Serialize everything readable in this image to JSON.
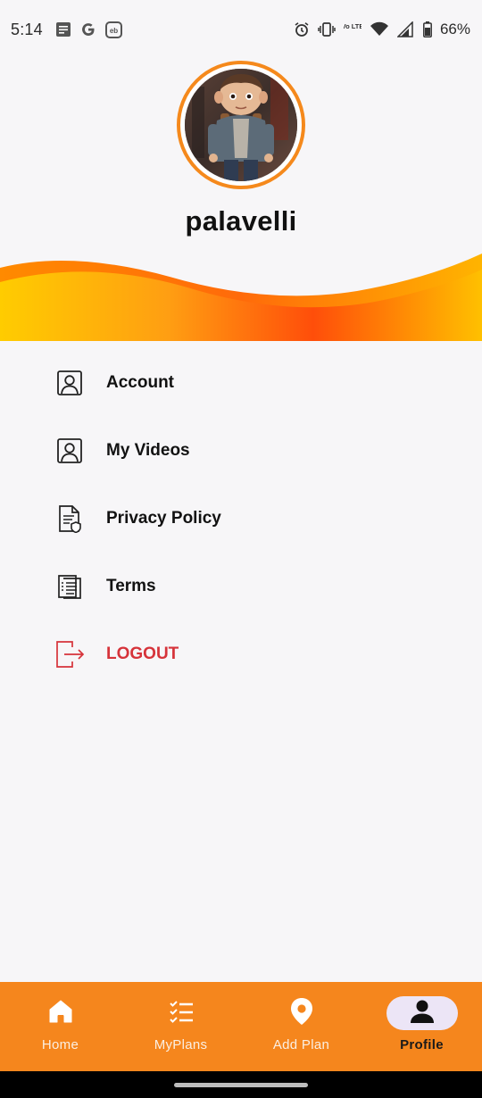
{
  "status_bar": {
    "time": "5:14",
    "left_icons": [
      "notes-icon",
      "google-icon",
      "eb-app-icon"
    ],
    "right_icons": [
      "alarm-icon",
      "vibrate-icon",
      "volte-icon",
      "wifi-icon",
      "signal-icon",
      "battery-icon"
    ],
    "battery": "66%",
    "volte_label": "Vo LTE",
    "eb_label": "eb"
  },
  "profile": {
    "username": "palavelli",
    "ring_color": "#f5891c"
  },
  "menu": {
    "items": [
      {
        "label": "Account",
        "icon": "account-icon"
      },
      {
        "label": "My Videos",
        "icon": "my-videos-icon"
      },
      {
        "label": "Privacy Policy",
        "icon": "privacy-policy-icon"
      },
      {
        "label": "Terms",
        "icon": "terms-icon"
      },
      {
        "label": "LOGOUT",
        "icon": "logout-icon"
      }
    ]
  },
  "bottom_nav": {
    "items": [
      {
        "label": "Home",
        "icon": "home-icon"
      },
      {
        "label": "MyPlans",
        "icon": "checklist-icon"
      },
      {
        "label": "Add Plan",
        "icon": "location-pin-icon"
      },
      {
        "label": "Profile",
        "icon": "person-icon",
        "active": true
      }
    ],
    "background": "#f5861d",
    "active_pill": "#ece5f6"
  },
  "colors": {
    "accent_orange": "#f5861d",
    "wave_yellow": "#fdc300",
    "wave_red_orange": "#ff4e0a",
    "logout_red": "#d6333a"
  }
}
